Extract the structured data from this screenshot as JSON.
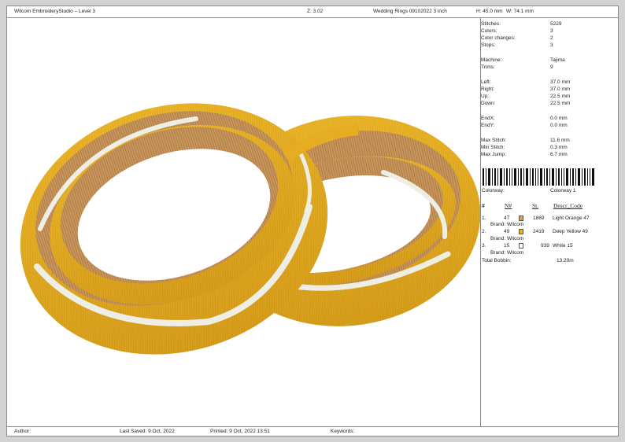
{
  "header": {
    "app_title": "Wilcom EmbroideryStudio – Level 3",
    "zoom": "Z: 3.02",
    "design_name": "Wedding Rings 09102022 3 inch",
    "height": "H: 45.0 mm",
    "width": "W: 74.1 mm"
  },
  "stats": [
    {
      "label": "Stitches:",
      "value": "5229"
    },
    {
      "label": "Colors:",
      "value": "3"
    },
    {
      "label": "Color changes:",
      "value": "2"
    },
    {
      "label": "Stops:",
      "value": "3"
    },
    {
      "label": "Machine:",
      "value": "Tajima"
    },
    {
      "label": "Trims:",
      "value": "9"
    },
    {
      "label": "Left:",
      "value": "37.0 mm"
    },
    {
      "label": "Right:",
      "value": "37.0 mm"
    },
    {
      "label": "Up:",
      "value": "22.5 mm"
    },
    {
      "label": "Down:",
      "value": "22.5 mm"
    },
    {
      "label": "EndX:",
      "value": "0.0 mm"
    },
    {
      "label": "EndY:",
      "value": "0.0 mm"
    },
    {
      "label": "Max Stitch:",
      "value": "11.6 mm"
    },
    {
      "label": "Min Stitch:",
      "value": "0.3 mm"
    },
    {
      "label": "Max Jump:",
      "value": "6.7 mm"
    }
  ],
  "colorway": {
    "label": "Colorway:",
    "value": "Colorway 1"
  },
  "color_table": {
    "headers": {
      "idx": "#",
      "num": "N#",
      "st": "St.",
      "desc": "Descr_Code"
    },
    "rows": [
      {
        "idx": "1.",
        "num": "47",
        "swatch": "#e6a23c",
        "st": "1869",
        "desc": "Light Orange 47",
        "brand": "Brand: Wilcom"
      },
      {
        "idx": "2.",
        "num": "49",
        "swatch": "#e8b11e",
        "st": "2419",
        "desc": "Deep Yellow 49",
        "brand": "Brand: Wilcom"
      },
      {
        "idx": "3.",
        "num": "15",
        "swatch": "#ffffff",
        "st": "939",
        "desc": "White 15",
        "brand": "Brand: Wilcom"
      }
    ],
    "total_label": "Total Bobbin:",
    "total_value": "13.20m"
  },
  "footer": {
    "author": "Author:",
    "last_saved": "Last Saved:  9 Oct, 2022",
    "printed": "Printed:  9 Oct, 2022 13:51",
    "keywords": "Keywords:"
  },
  "colors": {
    "gold": "#e8b11e",
    "tan": "#c8955c",
    "white_thread": "#eeeee4"
  }
}
